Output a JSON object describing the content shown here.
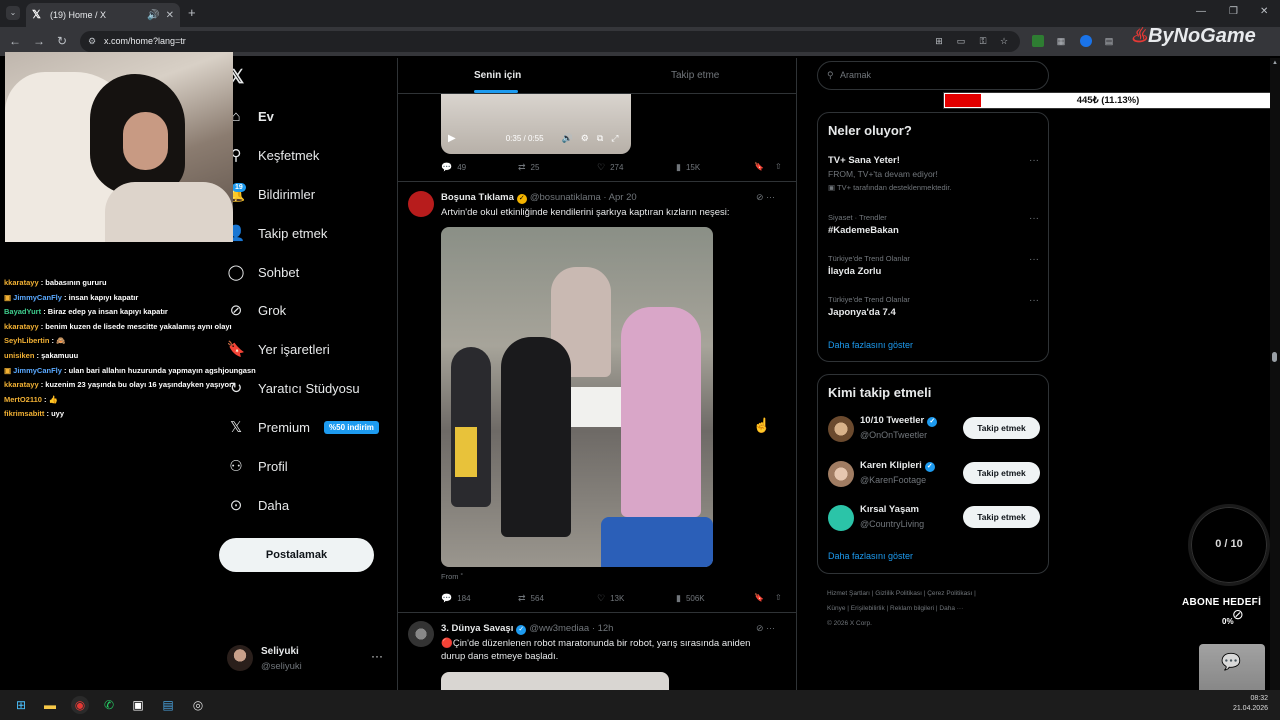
{
  "browser": {
    "tab_title": "(19) Home / X",
    "tab_favicon": "𝕏",
    "url": "x.com/home?lang=tr",
    "watermark": "ByNoGame"
  },
  "chat": [
    {
      "user": "kkaratayy",
      "msg": " : babasının gururu",
      "cls": "u1"
    },
    {
      "user": "JimmyCanFly",
      "msg": " : insan kapıyı kapatır",
      "cls": "u2",
      "icon": true
    },
    {
      "user": "BayadYurt",
      "msg": " : Biraz edep ya insan kapıyı kapatır",
      "cls": "u3"
    },
    {
      "user": "kkaratayy",
      "msg": " : benim kuzen de lisede mescitte yakalamış aynı olayı",
      "cls": "u1"
    },
    {
      "user": "SeyhLibertin",
      "msg": " : 🙈",
      "cls": "u1"
    },
    {
      "user": "unisiken",
      "msg": " : şakamuuu",
      "cls": "u1"
    },
    {
      "user": "JimmyCanFly",
      "msg": " : ulan bari allahın huzurunda yapmayın agshjoungasn",
      "cls": "u2",
      "icon": true
    },
    {
      "user": "kkaratayy",
      "msg": " : kuzenim 23 yaşında bu olayı 16 yaşındayken yaşıyor",
      "cls": "u1"
    },
    {
      "user": "MertO2110",
      "msg": " : 👍",
      "cls": "u1"
    },
    {
      "user": "fikrimsabitt",
      "msg": " : uyy",
      "cls": "u1"
    }
  ],
  "nav": {
    "items": [
      {
        "label": "Ev",
        "icon": "⌂"
      },
      {
        "label": "Keşfetmek",
        "icon": "⚲"
      },
      {
        "label": "Bildirimler",
        "icon": "🔔"
      },
      {
        "label": "Takip etmek",
        "icon": "👤"
      },
      {
        "label": "Sohbet",
        "icon": "◯"
      },
      {
        "label": "Grok",
        "icon": "⊘"
      },
      {
        "label": "Yer işaretleri",
        "icon": "🔖"
      },
      {
        "label": "Yaratıcı Stüdyosu",
        "icon": "↻"
      },
      {
        "label": "Premium",
        "icon": "𝕏"
      },
      {
        "label": "Profil",
        "icon": "⚇"
      },
      {
        "label": "Daha",
        "icon": "⊙"
      }
    ],
    "notif_count": "19",
    "premium_promo": "%50 indirim",
    "post_button": "Postalamak",
    "account_name": "Seliyuki",
    "account_handle": "@seliyuki"
  },
  "main": {
    "tab_for_you": "Senin için",
    "tab_following": "Takip etme",
    "video_time": "0:35 / 0:55",
    "tweets": [
      {
        "replies": "49",
        "retweets": "25",
        "likes": "274",
        "views": "15K"
      },
      {
        "name": "Boşuna Tıklama",
        "handle": "@bosunatiklama",
        "date": "· Apr 20",
        "text": "Artvin'de okul etkinliğinde kendilerini şarkıya kaptıran kızların neşesi:",
        "from": "From ˚",
        "replies": "184",
        "retweets": "564",
        "likes": "13K",
        "views": "506K"
      },
      {
        "name": "3. Dünya Savaşı",
        "handle": "@ww3mediaa",
        "date": "· 12h",
        "text": "🔴Çin'de düzenlenen robot maratonunda bir robot, yarış sırasında aniden durup dans etmeye başladı."
      }
    ]
  },
  "right": {
    "search_placeholder": "Aramak",
    "donation_label": "445₺ (11.13%)",
    "donation_fraction": 0.1113,
    "trends_title": "Neler oluyor?",
    "trends": [
      {
        "meta": "",
        "title": "TV+ Sana Yeter!",
        "sub": "FROM, TV+'ta devam ediyor!",
        "promoted": "TV+ tarafından desteklenmektedir."
      },
      {
        "meta": "Siyaset · Trendler",
        "title": "#KademeBakan"
      },
      {
        "meta": "Türkiye'de Trend Olanlar",
        "title": "İlayda Zorlu"
      },
      {
        "meta": "Türkiye'de Trend Olanlar",
        "title": "Japonya'da 7.4"
      }
    ],
    "show_more": "Daha fazlasını göster",
    "who_title": "Kimi takip etmeli",
    "who": [
      {
        "name": "10/10 Tweetler",
        "handle": "@OnOnTweetler",
        "verified": true
      },
      {
        "name": "Karen Klipleri",
        "handle": "@KarenFootage",
        "verified": true
      },
      {
        "name": "Kırsal Yaşam",
        "handle": "@CountryLiving",
        "verified": false
      }
    ],
    "follow_label": "Takip etmek",
    "footer": [
      "Hizmet Şartları",
      "Gizlilik Politikası",
      "Çerez Politikası",
      "Künye",
      "Erişilebilirlik",
      "Reklam bilgileri",
      "Daha ···",
      "© 2026 X Corp."
    ]
  },
  "overlay": {
    "sub_goal_count": "0 / 10",
    "sub_goal_title": "ABONE HEDEFİ",
    "sub_goal_pct": "0%"
  },
  "taskbar": {
    "time": "08:32",
    "date": "21.04.2026"
  }
}
